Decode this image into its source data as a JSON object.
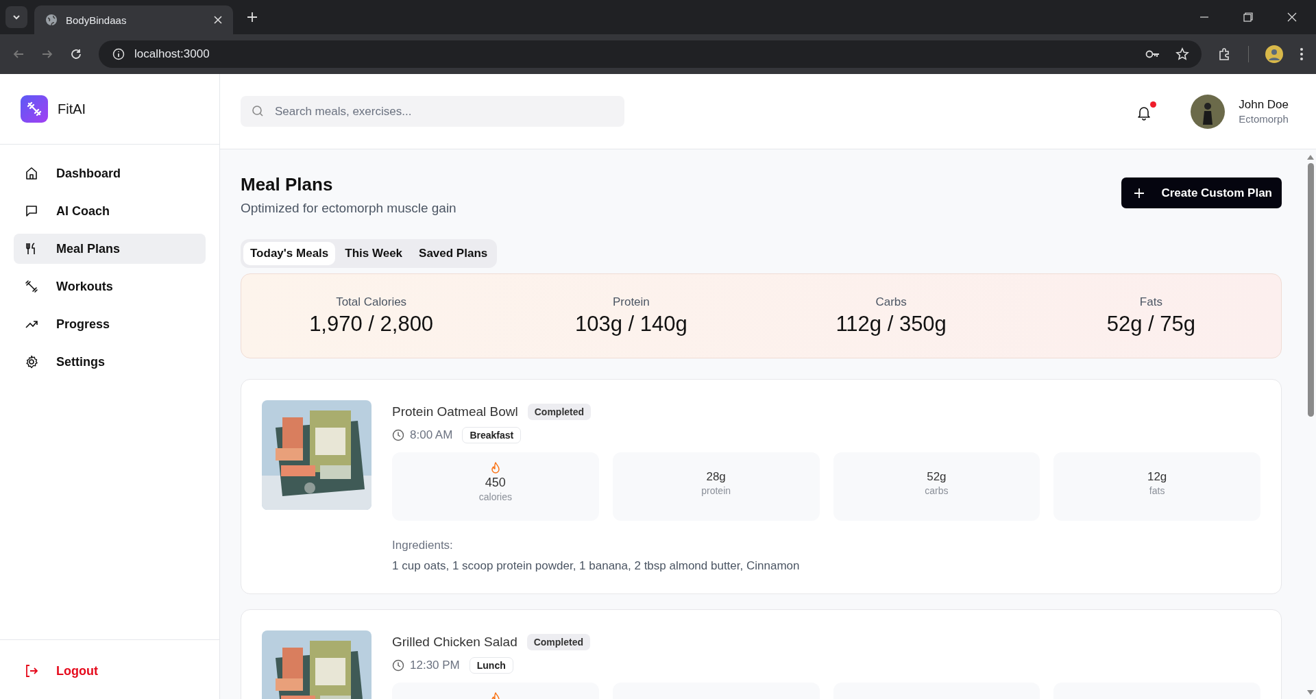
{
  "browser": {
    "tab_title": "BodyBindaas",
    "url": "localhost:3000"
  },
  "sidebar": {
    "logo": "FitAI",
    "items": [
      {
        "label": "Dashboard",
        "kind": "home",
        "selected": false
      },
      {
        "label": "AI Coach",
        "kind": "chat",
        "selected": false
      },
      {
        "label": "Meal Plans",
        "kind": "meals",
        "selected": true
      },
      {
        "label": "Workouts",
        "kind": "workouts",
        "selected": false
      },
      {
        "label": "Progress",
        "kind": "progress",
        "selected": false
      },
      {
        "label": "Settings",
        "kind": "settings",
        "selected": false
      }
    ],
    "logout": "Logout"
  },
  "header": {
    "search": {
      "placeholder": "Search meals, exercises..."
    },
    "notifications": {
      "unread": true
    },
    "user": {
      "name": "John Doe",
      "subtitle": "Ectomorph"
    }
  },
  "page": {
    "title": "Meal Plans",
    "subtitle": "Optimized for ectomorph muscle gain",
    "action": "Create Custom Plan",
    "tabs": [
      {
        "label": "Today's Meals",
        "selected": true
      },
      {
        "label": "This Week",
        "selected": false
      },
      {
        "label": "Saved Plans",
        "selected": false
      }
    ],
    "summary": [
      {
        "label": "Total Calories",
        "value": "1,970 / 2,800"
      },
      {
        "label": "Protein",
        "value": "103g / 140g"
      },
      {
        "label": "Carbs",
        "value": "112g / 350g"
      },
      {
        "label": "Fats",
        "value": "52g / 75g"
      }
    ],
    "meals": [
      {
        "name": "Protein Oatmeal Bowl",
        "status": "Completed",
        "time": "8:00 AM",
        "type": "Breakfast",
        "macros": [
          {
            "kind": "calories",
            "value": "450",
            "label": "calories"
          },
          {
            "kind": "macro",
            "value": "28g",
            "label": "protein"
          },
          {
            "kind": "macro",
            "value": "52g",
            "label": "carbs"
          },
          {
            "kind": "macro",
            "value": "12g",
            "label": "fats"
          }
        ],
        "ingredients_label": "Ingredients:",
        "ingredients": "1 cup oats, 1 scoop protein powder, 1 banana, 2 tbsp almond butter, Cinnamon"
      },
      {
        "name": "Grilled Chicken Salad",
        "status": "Completed",
        "time": "12:30 PM",
        "type": "Lunch",
        "macros": [
          {
            "kind": "calories"
          },
          {
            "kind": "macro"
          },
          {
            "kind": "macro"
          },
          {
            "kind": "macro"
          }
        ]
      }
    ]
  }
}
